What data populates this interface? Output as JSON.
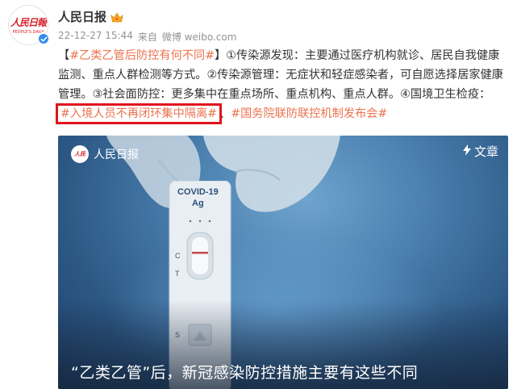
{
  "user": {
    "name": "人民日报",
    "avatar_text": "人民日報",
    "avatar_subtext": "PEOPLE'S DAILY",
    "badge_icon": "crown-icon",
    "verified_icon": "verified-check-icon"
  },
  "meta": {
    "time": "22-12-27 15:44",
    "source_prefix": "来自",
    "source": "微博 weibo.com"
  },
  "content": {
    "bracket_open": "【",
    "tag_main": "#乙类乙管后防控有何不同#",
    "bracket_close": "】",
    "text_1": "①传染源发现：主要通过医疗机构就诊、居民自我健康监测、重点人群检测等方式。②传染源管理：无症状和轻症感染者，可自愿选择居家健康管理。③社会面防控：更多集中在重点场所、重点机构、重点人群。④国境卫生检疫：",
    "tag_boxed": "#入境人员不再闭环集中隔离#",
    "separator": "、",
    "tag_last": "#国务院联防联控机制发布会#"
  },
  "media": {
    "author_name": "人民日报",
    "article_label": "文章",
    "article_icon": "lightning-icon",
    "card_label_1": "COVID-19",
    "card_label_2": "Ag",
    "mark_c": "C",
    "mark_t": "T",
    "mark_s": "S",
    "caption": "“乙类乙管”后，新冠感染防控措施主要有这些不同"
  },
  "colors": {
    "hashtag": "#eb7350",
    "highlight_box": "#e0141e",
    "verified": "#2f8df0"
  }
}
